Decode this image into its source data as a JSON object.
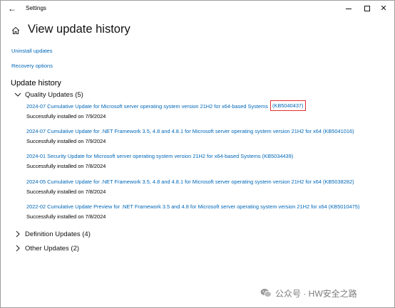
{
  "window": {
    "title": "Settings",
    "back_glyph": "←",
    "close_glyph": "✕"
  },
  "page": {
    "title": "View update history",
    "uninstall_link": "Uninstall updates",
    "recovery_link": "Recovery options",
    "section_heading": "Update history"
  },
  "groups": {
    "quality": {
      "label": "Quality Updates (5)",
      "expanded": true
    },
    "definition": {
      "label": "Definition Updates (4)",
      "expanded": false
    },
    "other": {
      "label": "Other Updates (2)",
      "expanded": false
    }
  },
  "updates": [
    {
      "title": "2024-07 Cumulative Update for Microsoft server operating system version 21H2 for x64-based Systems",
      "kb": "(KB5040437)",
      "highlighted": true,
      "status": "Successfully installed on 7/9/2024"
    },
    {
      "title": "2024-07 Cumulative Update for .NET Framework 3.5, 4.8 and 4.8.1 for Microsoft server operating system version 21H2 for x64 (KB5041016)",
      "status": "Successfully installed on 7/9/2024"
    },
    {
      "title": "2024-01 Security Update for Microsoft server operating system version 21H2 for x64-based Systems (KB5034439)",
      "status": "Successfully installed on 7/8/2024"
    },
    {
      "title": "2024-05 Cumulative Update for .NET Framework 3.5, 4.8 and 4.8.1 for Microsoft server operating system version 21H2 for x64 (KB5038282)",
      "status": "Successfully installed on 7/8/2024"
    },
    {
      "title": "2022-02 Cumulative Update Preview for .NET Framework 3.5 and 4.8 for Microsoft server operating system version 21H2 for x64 (KB5010475)",
      "status": "Successfully installed on 7/8/2024"
    }
  ],
  "watermark": {
    "text": "公众号 · HW安全之路"
  },
  "colors": {
    "link": "#0067b8",
    "highlight_box": "#e03030",
    "watermark": "#7c7c7c"
  },
  "icons": {
    "back": "back-arrow-icon",
    "home": "home-icon",
    "expanded": "chevron-down-icon",
    "collapsed": "chevron-right-icon",
    "watermark": "wechat-icon"
  }
}
